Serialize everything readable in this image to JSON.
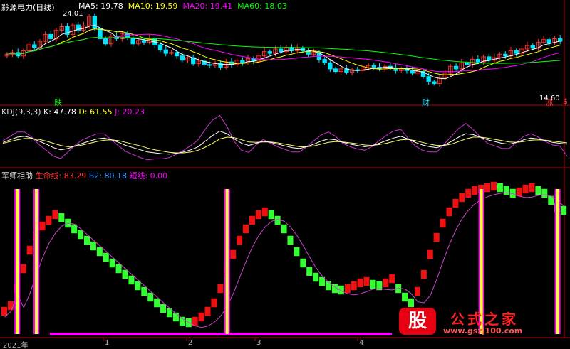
{
  "header": {
    "stock": "黔源电力(日线)",
    "ma": [
      {
        "label": "MA5: 19.78",
        "color": "#ffffff"
      },
      {
        "label": "MA10: 19.59",
        "color": "#ffff00"
      },
      {
        "label": "MA20: 19.41",
        "color": "#ff00ff"
      },
      {
        "label": "MA60: 18.03",
        "color": "#00ff00"
      }
    ]
  },
  "kdj": {
    "title": "KDJ(9,3,3)",
    "k": "K: 47.78",
    "d": "D: 61.55",
    "j": "J: 20.23"
  },
  "ind": {
    "title": "军师相助",
    "s1": "生命线: 83.29",
    "s2": "B2: 80.18",
    "s3": "短线: 0.00"
  },
  "annotations": {
    "high": "24.01",
    "low": "14.60",
    "tag_die": "跌",
    "tag_cai": "财",
    "tag_zhang": "涨"
  },
  "xaxis": {
    "labels": [
      "2021年",
      "1",
      "2",
      "3",
      "4"
    ]
  },
  "watermark": {
    "icon": "股",
    "name": "公式之家",
    "url": "www.gszj100.com"
  },
  "colors": {
    "up": "#ff3030",
    "down": "#00e5ff",
    "green_bar": "#33ff33",
    "red_bar": "#ee1111",
    "spike": "#ffff33",
    "magenta": "#ff00ff",
    "frame": "#b40000"
  },
  "chart_data": [
    {
      "type": "candlestick",
      "title": "黔源电力(日线)",
      "yrange": [
        14.6,
        24.01
      ],
      "annotations": {
        "max": 24.01,
        "min": 14.6
      },
      "series": [
        {
          "name": "MA5",
          "last": 19.78
        },
        {
          "name": "MA10",
          "last": 19.59
        },
        {
          "name": "MA20",
          "last": 19.41
        },
        {
          "name": "MA60",
          "last": 18.03
        }
      ],
      "closes": [
        19.2,
        19.4,
        19.0,
        19.6,
        20.3,
        20.0,
        20.7,
        21.5,
        21.0,
        22.0,
        22.4,
        21.5,
        22.6,
        22.0,
        22.5,
        23.6,
        22.2,
        21.0,
        20.4,
        21.3,
        21.0,
        21.6,
        21.1,
        20.4,
        20.8,
        20.6,
        21.0,
        20.3,
        19.7,
        19.3,
        19.4,
        19.0,
        18.5,
        18.8,
        18.1,
        18.4,
        18.0,
        17.9,
        18.2,
        17.7,
        18.3,
        18.0,
        18.5,
        18.2,
        18.7,
        18.4,
        19.0,
        19.5,
        19.3,
        19.8,
        19.5,
        20.0,
        19.6,
        19.9,
        19.6,
        19.2,
        19.4,
        18.6,
        18.2,
        17.5,
        17.2,
        17.5,
        17.1,
        17.4,
        17.3,
        17.6,
        17.9,
        17.7,
        17.5,
        17.8,
        17.6,
        17.3,
        17.5,
        17.3,
        17.0,
        17.2,
        16.6,
        16.0,
        15.8,
        16.4,
        17.0,
        17.8,
        17.5,
        18.2,
        18.0,
        18.6,
        18.3,
        18.9,
        18.5,
        18.8,
        19.2,
        19.0,
        19.6,
        19.3,
        19.8,
        20.2,
        19.9,
        20.6,
        20.9,
        20.5,
        21.0,
        20.7
      ]
    },
    {
      "type": "line",
      "title": "KDJ(9,3,3)",
      "series": [
        {
          "name": "K",
          "last": 47.78
        },
        {
          "name": "D",
          "last": 61.55
        },
        {
          "name": "J",
          "last": 20.23
        }
      ],
      "K": [
        52,
        58,
        64,
        66,
        62,
        55,
        48,
        40,
        35,
        38,
        44,
        50,
        55,
        60,
        62,
        58,
        52,
        45,
        40,
        35,
        30,
        28,
        26,
        25,
        27,
        30,
        35,
        42,
        55,
        68,
        78,
        72,
        60,
        50,
        45,
        50,
        55,
        52,
        48,
        44,
        40,
        38,
        42,
        48,
        55,
        60,
        58,
        52,
        48,
        45,
        42,
        44,
        50,
        56,
        62,
        66,
        60,
        52,
        46,
        42,
        40,
        46,
        54,
        64,
        72,
        70,
        64,
        58,
        54,
        50,
        48,
        52,
        58,
        62,
        60,
        56,
        52,
        50,
        48
      ],
      "D": [
        50,
        54,
        58,
        61,
        61,
        59,
        55,
        50,
        45,
        42,
        43,
        46,
        50,
        54,
        57,
        58,
        56,
        52,
        48,
        44,
        39,
        35,
        32,
        29,
        28,
        28,
        30,
        34,
        41,
        50,
        60,
        64,
        63,
        58,
        53,
        52,
        53,
        53,
        51,
        48,
        45,
        42,
        42,
        44,
        48,
        52,
        54,
        53,
        51,
        49,
        46,
        45,
        47,
        50,
        54,
        58,
        59,
        56,
        52,
        48,
        45,
        45,
        48,
        54,
        60,
        64,
        64,
        62,
        59,
        56,
        53,
        52,
        54,
        57,
        58,
        57,
        55,
        53,
        51
      ],
      "J": [
        56,
        66,
        76,
        76,
        64,
        47,
        34,
        20,
        15,
        30,
        46,
        58,
        65,
        72,
        72,
        58,
        44,
        31,
        24,
        17,
        12,
        14,
        14,
        17,
        25,
        34,
        45,
        58,
        83,
        104,
        114,
        88,
        54,
        34,
        29,
        46,
        59,
        50,
        42,
        36,
        30,
        30,
        42,
        56,
        69,
        76,
        66,
        50,
        42,
        37,
        34,
        42,
        56,
        68,
        78,
        82,
        62,
        44,
        34,
        30,
        30,
        48,
        66,
        84,
        96,
        82,
        64,
        50,
        44,
        38,
        38,
        52,
        66,
        72,
        64,
        54,
        46,
        44,
        20
      ]
    },
    {
      "type": "bar",
      "title": "军师相助",
      "series": [
        {
          "name": "生命线",
          "last": 83.29
        },
        {
          "name": "B2",
          "last": 80.18
        },
        {
          "name": "短线",
          "last": 0.0
        }
      ],
      "values": [
        12,
        16,
        28,
        42,
        55,
        65,
        72,
        76,
        80,
        78,
        74,
        70,
        66,
        62,
        58,
        54,
        50,
        46,
        42,
        38,
        34,
        30,
        26,
        22,
        18,
        14,
        11,
        8,
        5,
        4,
        5,
        8,
        12,
        18,
        28,
        40,
        52,
        62,
        70,
        76,
        80,
        82,
        80,
        76,
        70,
        62,
        54,
        46,
        40,
        36,
        33,
        30,
        28,
        27,
        28,
        30,
        32,
        33,
        31,
        30,
        32,
        35,
        28,
        22,
        18,
        26,
        38,
        52,
        64,
        74,
        82,
        88,
        92,
        95,
        97,
        98,
        99,
        100,
        99,
        97,
        95,
        96,
        98,
        99,
        97,
        95,
        90,
        85,
        83
      ],
      "spikes_index": [
        2,
        5,
        35,
        75,
        87
      ]
    }
  ]
}
